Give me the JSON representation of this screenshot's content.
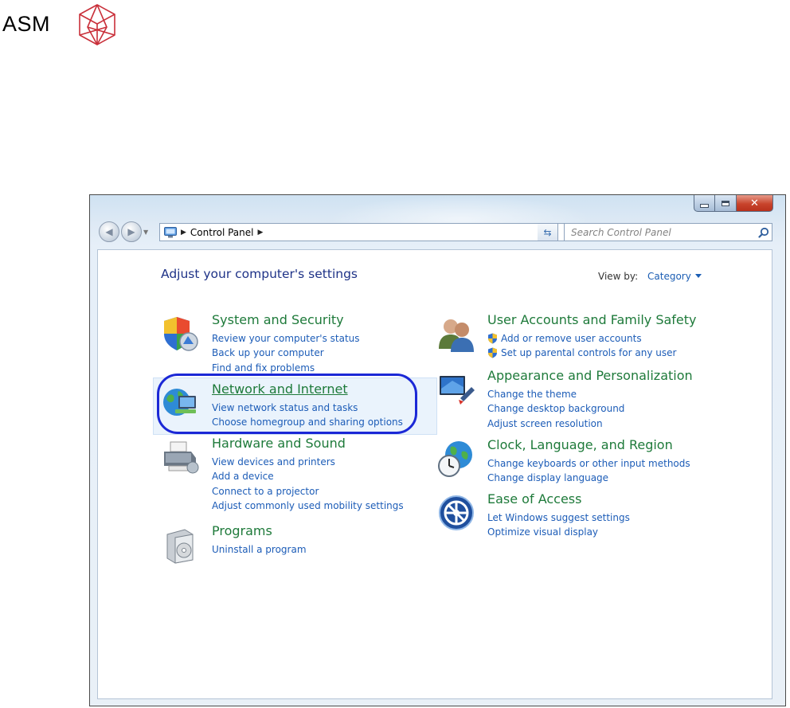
{
  "logo": {
    "text": "ASM"
  },
  "window": {
    "address": {
      "breadcrumb": "Control Panel",
      "search_placeholder": "Search Control Panel"
    },
    "title": "Adjust your computer's settings",
    "view_by": {
      "label": "View by:",
      "value": "Category"
    },
    "categories_left": [
      {
        "title": "System and Security",
        "links": [
          "Review your computer's status",
          "Back up your computer",
          "Find and fix problems"
        ]
      },
      {
        "title": "Network and Internet",
        "links": [
          "View network status and tasks",
          "Choose homegroup and sharing options"
        ]
      },
      {
        "title": "Hardware and Sound",
        "links": [
          "View devices and printers",
          "Add a device",
          "Connect to a projector",
          "Adjust commonly used mobility settings"
        ]
      },
      {
        "title": "Programs",
        "links": [
          "Uninstall a program"
        ]
      }
    ],
    "categories_right": [
      {
        "title": "User Accounts and Family Safety",
        "links": [
          "Add or remove user accounts",
          "Set up parental controls for any user"
        ]
      },
      {
        "title": "Appearance and Personalization",
        "links": [
          "Change the theme",
          "Change desktop background",
          "Adjust screen resolution"
        ]
      },
      {
        "title": "Clock, Language, and Region",
        "links": [
          "Change keyboards or other input methods",
          "Change display language"
        ]
      },
      {
        "title": "Ease of Access",
        "links": [
          "Let Windows suggest settings",
          "Optimize visual display"
        ]
      }
    ]
  },
  "colors": {
    "category_title": "#1e7a3a",
    "link": "#1c5cb7",
    "highlight_ring": "#1b28d6",
    "logo_mark": "#c9303a"
  }
}
